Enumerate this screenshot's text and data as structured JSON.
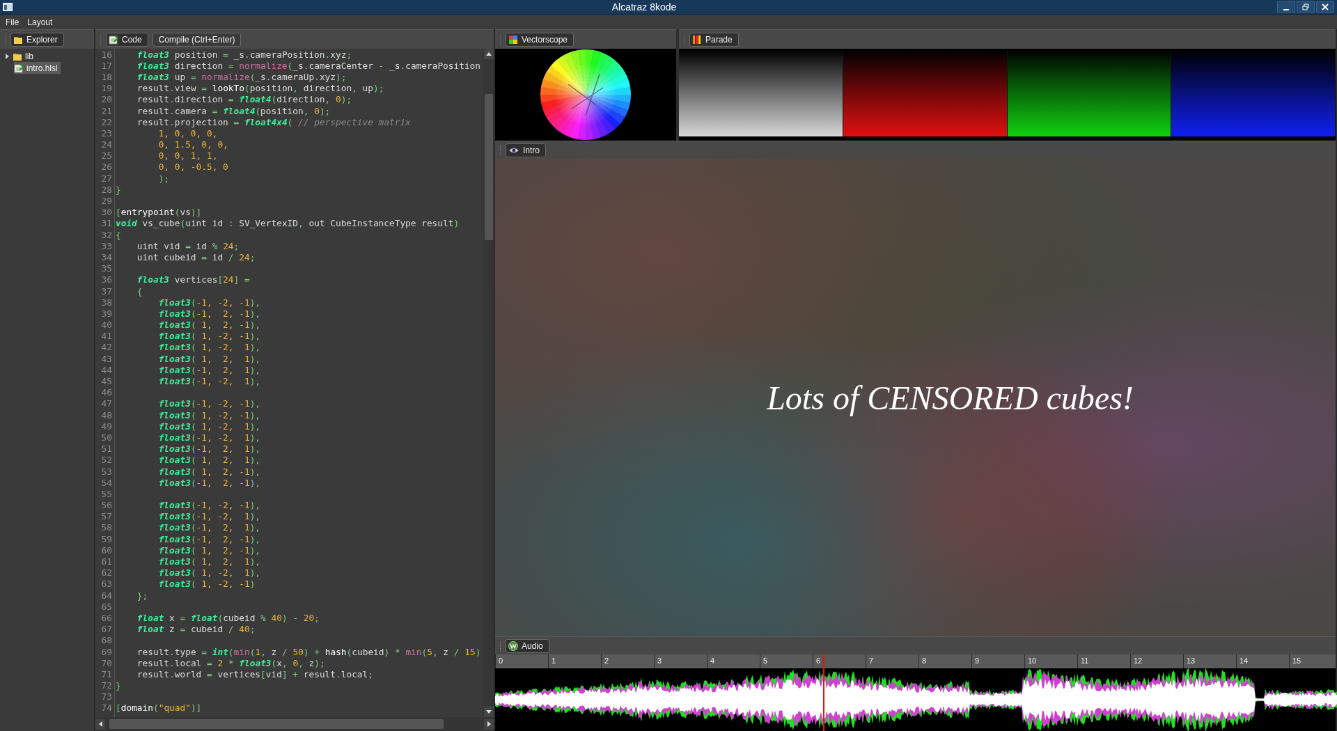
{
  "window": {
    "title": "Alcatraz 8kode"
  },
  "menu": [
    "File",
    "Layout"
  ],
  "explorer": {
    "tab": "Explorer",
    "items": [
      {
        "label": "lib",
        "kind": "folder",
        "expanded": false,
        "selected": false
      },
      {
        "label": "intro.hlsl",
        "kind": "file",
        "selected": true
      }
    ]
  },
  "editor": {
    "tab": "Code",
    "compile_button": "Compile (Ctrl+Enter)",
    "lines": [
      {
        "number": "16",
        "tokens": [
          {
            "kind": "type",
            "text": "    float3"
          },
          {
            "kind": "text",
            "text": " position = _s.cameraPosition.xyz;"
          }
        ]
      },
      {
        "number": "17",
        "tokens": [
          {
            "kind": "type",
            "text": "    float3"
          },
          {
            "kind": "text",
            "text": " direction = "
          },
          {
            "kind": "fn",
            "text": "normalize"
          },
          {
            "kind": "text",
            "text": "(_s.cameraCenter - _s.cameraPosition"
          }
        ]
      },
      {
        "number": "18",
        "tokens": [
          {
            "kind": "type",
            "text": "    float3"
          },
          {
            "kind": "text",
            "text": " up = "
          },
          {
            "kind": "fn",
            "text": "normalize"
          },
          {
            "kind": "text",
            "text": "(_s.cameraUp.xyz);"
          }
        ]
      },
      {
        "number": "19",
        "tokens": [
          {
            "kind": "text",
            "text": "    result.view = "
          },
          {
            "kind": "call",
            "text": "lookTo"
          },
          {
            "kind": "text",
            "text": "(position, direction, up);"
          }
        ]
      },
      {
        "number": "20",
        "tokens": [
          {
            "kind": "text",
            "text": "    result.direction = "
          },
          {
            "kind": "type",
            "text": "float4"
          },
          {
            "kind": "text",
            "text": "(direction, "
          },
          {
            "kind": "num",
            "text": "0"
          },
          {
            "kind": "text",
            "text": ");"
          }
        ]
      },
      {
        "number": "21",
        "tokens": [
          {
            "kind": "text",
            "text": "    result.camera = "
          },
          {
            "kind": "type",
            "text": "float4"
          },
          {
            "kind": "text",
            "text": "(position, "
          },
          {
            "kind": "num",
            "text": "0"
          },
          {
            "kind": "text",
            "text": ");"
          }
        ]
      },
      {
        "number": "22",
        "tokens": [
          {
            "kind": "text",
            "text": "    result.projection = "
          },
          {
            "kind": "type",
            "text": "float4x4"
          },
          {
            "kind": "text",
            "text": "( "
          },
          {
            "kind": "comment",
            "text": "// perspective matrix"
          }
        ]
      },
      {
        "number": "23",
        "tokens": [
          {
            "kind": "num",
            "text": "        1, 0, 0, 0,"
          }
        ]
      },
      {
        "number": "24",
        "tokens": [
          {
            "kind": "num",
            "text": "        0, 1.5, 0, 0,"
          }
        ]
      },
      {
        "number": "25",
        "tokens": [
          {
            "kind": "num",
            "text": "        0, 0, 1, 1,"
          }
        ]
      },
      {
        "number": "26",
        "tokens": [
          {
            "kind": "num",
            "text": "        0, 0, -0.5, 0"
          }
        ]
      },
      {
        "number": "27",
        "tokens": [
          {
            "kind": "text",
            "text": "        );"
          }
        ]
      },
      {
        "number": "28",
        "tokens": [
          {
            "kind": "text",
            "text": "}"
          }
        ]
      },
      {
        "number": "29"
      },
      {
        "number": "30",
        "tokens": [
          {
            "kind": "text",
            "text": "["
          },
          {
            "kind": "call",
            "text": "entrypoint"
          },
          {
            "kind": "text",
            "text": "(vs)]"
          }
        ]
      },
      {
        "number": "31",
        "tokens": [
          {
            "kind": "type",
            "text": "void"
          },
          {
            "kind": "text",
            "text": " vs_cube(uint id : SV_VertexID, out CubeInstanceType result)"
          }
        ]
      },
      {
        "number": "32",
        "tokens": [
          {
            "kind": "text",
            "text": "{"
          }
        ]
      },
      {
        "number": "33",
        "tokens": [
          {
            "kind": "text",
            "text": "    uint vid = id % "
          },
          {
            "kind": "num",
            "text": "24"
          },
          {
            "kind": "text",
            "text": ";"
          }
        ]
      },
      {
        "number": "34",
        "tokens": [
          {
            "kind": "text",
            "text": "    uint cubeid = id / "
          },
          {
            "kind": "num",
            "text": "24"
          },
          {
            "kind": "text",
            "text": ";"
          }
        ]
      },
      {
        "number": "35"
      },
      {
        "number": "36",
        "tokens": [
          {
            "kind": "type",
            "text": "    float3"
          },
          {
            "kind": "text",
            "text": " vertices["
          },
          {
            "kind": "num",
            "text": "24"
          },
          {
            "kind": "text",
            "text": "] ="
          }
        ]
      },
      {
        "number": "37",
        "tokens": [
          {
            "kind": "text",
            "text": "    {"
          }
        ]
      },
      {
        "number": "38",
        "tokens": [
          {
            "kind": "type",
            "text": "        float3"
          },
          {
            "kind": "text",
            "text": "("
          },
          {
            "kind": "num",
            "text": "-1, -2, -1"
          },
          {
            "kind": "text",
            "text": "),"
          }
        ]
      },
      {
        "number": "39",
        "tokens": [
          {
            "kind": "type",
            "text": "        float3"
          },
          {
            "kind": "text",
            "text": "("
          },
          {
            "kind": "num",
            "text": "-1,  2, -1"
          },
          {
            "kind": "text",
            "text": "),"
          }
        ]
      },
      {
        "number": "40",
        "tokens": [
          {
            "kind": "type",
            "text": "        float3"
          },
          {
            "kind": "text",
            "text": "("
          },
          {
            "kind": "num",
            "text": " 1,  2, -1"
          },
          {
            "kind": "text",
            "text": "),"
          }
        ]
      },
      {
        "number": "41",
        "tokens": [
          {
            "kind": "type",
            "text": "        float3"
          },
          {
            "kind": "text",
            "text": "("
          },
          {
            "kind": "num",
            "text": " 1, -2, -1"
          },
          {
            "kind": "text",
            "text": "),"
          }
        ]
      },
      {
        "number": "42",
        "tokens": [
          {
            "kind": "type",
            "text": "        float3"
          },
          {
            "kind": "text",
            "text": "("
          },
          {
            "kind": "num",
            "text": " 1, -2,  1"
          },
          {
            "kind": "text",
            "text": "),"
          }
        ]
      },
      {
        "number": "43",
        "tokens": [
          {
            "kind": "type",
            "text": "        float3"
          },
          {
            "kind": "text",
            "text": "("
          },
          {
            "kind": "num",
            "text": " 1,  2,  1"
          },
          {
            "kind": "text",
            "text": "),"
          }
        ]
      },
      {
        "number": "44",
        "tokens": [
          {
            "kind": "type",
            "text": "        float3"
          },
          {
            "kind": "text",
            "text": "("
          },
          {
            "kind": "num",
            "text": "-1,  2,  1"
          },
          {
            "kind": "text",
            "text": "),"
          }
        ]
      },
      {
        "number": "45",
        "tokens": [
          {
            "kind": "type",
            "text": "        float3"
          },
          {
            "kind": "text",
            "text": "("
          },
          {
            "kind": "num",
            "text": "-1, -2,  1"
          },
          {
            "kind": "text",
            "text": "),"
          }
        ]
      },
      {
        "number": "46"
      },
      {
        "number": "47",
        "tokens": [
          {
            "kind": "type",
            "text": "        float3"
          },
          {
            "kind": "text",
            "text": "("
          },
          {
            "kind": "num",
            "text": "-1, -2, -1"
          },
          {
            "kind": "text",
            "text": "),"
          }
        ]
      },
      {
        "number": "48",
        "tokens": [
          {
            "kind": "type",
            "text": "        float3"
          },
          {
            "kind": "text",
            "text": "("
          },
          {
            "kind": "num",
            "text": " 1, -2, -1"
          },
          {
            "kind": "text",
            "text": "),"
          }
        ]
      },
      {
        "number": "49",
        "tokens": [
          {
            "kind": "type",
            "text": "        float3"
          },
          {
            "kind": "text",
            "text": "("
          },
          {
            "kind": "num",
            "text": " 1, -2,  1"
          },
          {
            "kind": "text",
            "text": "),"
          }
        ]
      },
      {
        "number": "50",
        "tokens": [
          {
            "kind": "type",
            "text": "        float3"
          },
          {
            "kind": "text",
            "text": "("
          },
          {
            "kind": "num",
            "text": "-1, -2,  1"
          },
          {
            "kind": "text",
            "text": "),"
          }
        ]
      },
      {
        "number": "51",
        "tokens": [
          {
            "kind": "type",
            "text": "        float3"
          },
          {
            "kind": "text",
            "text": "("
          },
          {
            "kind": "num",
            "text": "-1,  2,  1"
          },
          {
            "kind": "text",
            "text": "),"
          }
        ]
      },
      {
        "number": "52",
        "tokens": [
          {
            "kind": "type",
            "text": "        float3"
          },
          {
            "kind": "text",
            "text": "("
          },
          {
            "kind": "num",
            "text": " 1,  2,  1"
          },
          {
            "kind": "text",
            "text": "),"
          }
        ]
      },
      {
        "number": "53",
        "tokens": [
          {
            "kind": "type",
            "text": "        float3"
          },
          {
            "kind": "text",
            "text": "("
          },
          {
            "kind": "num",
            "text": " 1,  2, -1"
          },
          {
            "kind": "text",
            "text": "),"
          }
        ]
      },
      {
        "number": "54",
        "tokens": [
          {
            "kind": "type",
            "text": "        float3"
          },
          {
            "kind": "text",
            "text": "("
          },
          {
            "kind": "num",
            "text": "-1,  2, -1"
          },
          {
            "kind": "text",
            "text": "),"
          }
        ]
      },
      {
        "number": "55"
      },
      {
        "number": "56",
        "tokens": [
          {
            "kind": "type",
            "text": "        float3"
          },
          {
            "kind": "text",
            "text": "("
          },
          {
            "kind": "num",
            "text": "-1, -2, -1"
          },
          {
            "kind": "text",
            "text": "),"
          }
        ]
      },
      {
        "number": "57",
        "tokens": [
          {
            "kind": "type",
            "text": "        float3"
          },
          {
            "kind": "text",
            "text": "("
          },
          {
            "kind": "num",
            "text": "-1, -2,  1"
          },
          {
            "kind": "text",
            "text": "),"
          }
        ]
      },
      {
        "number": "58",
        "tokens": [
          {
            "kind": "type",
            "text": "        float3"
          },
          {
            "kind": "text",
            "text": "("
          },
          {
            "kind": "num",
            "text": "-1,  2,  1"
          },
          {
            "kind": "text",
            "text": "),"
          }
        ]
      },
      {
        "number": "59",
        "tokens": [
          {
            "kind": "type",
            "text": "        float3"
          },
          {
            "kind": "text",
            "text": "("
          },
          {
            "kind": "num",
            "text": "-1,  2, -1"
          },
          {
            "kind": "text",
            "text": "),"
          }
        ]
      },
      {
        "number": "60",
        "tokens": [
          {
            "kind": "type",
            "text": "        float3"
          },
          {
            "kind": "text",
            "text": "("
          },
          {
            "kind": "num",
            "text": " 1,  2, -1"
          },
          {
            "kind": "text",
            "text": "),"
          }
        ]
      },
      {
        "number": "61",
        "tokens": [
          {
            "kind": "type",
            "text": "        float3"
          },
          {
            "kind": "text",
            "text": "("
          },
          {
            "kind": "num",
            "text": " 1,  2,  1"
          },
          {
            "kind": "text",
            "text": "),"
          }
        ]
      },
      {
        "number": "62",
        "tokens": [
          {
            "kind": "type",
            "text": "        float3"
          },
          {
            "kind": "text",
            "text": "("
          },
          {
            "kind": "num",
            "text": " 1, -2,  1"
          },
          {
            "kind": "text",
            "text": "),"
          }
        ]
      },
      {
        "number": "63",
        "tokens": [
          {
            "kind": "type",
            "text": "        float3"
          },
          {
            "kind": "text",
            "text": "("
          },
          {
            "kind": "num",
            "text": " 1, -2, -1"
          },
          {
            "kind": "text",
            "text": ")"
          }
        ]
      },
      {
        "number": "64",
        "tokens": [
          {
            "kind": "text",
            "text": "    };"
          }
        ]
      },
      {
        "number": "65"
      },
      {
        "number": "66",
        "tokens": [
          {
            "kind": "type",
            "text": "    float"
          },
          {
            "kind": "text",
            "text": " x = "
          },
          {
            "kind": "type",
            "text": "float"
          },
          {
            "kind": "text",
            "text": "(cubeid % "
          },
          {
            "kind": "num",
            "text": "40"
          },
          {
            "kind": "text",
            "text": ") - "
          },
          {
            "kind": "num",
            "text": "20"
          },
          {
            "kind": "text",
            "text": ";"
          }
        ]
      },
      {
        "number": "67",
        "tokens": [
          {
            "kind": "type",
            "text": "    float"
          },
          {
            "kind": "text",
            "text": " z = cubeid / "
          },
          {
            "kind": "num",
            "text": "40"
          },
          {
            "kind": "text",
            "text": ";"
          }
        ]
      },
      {
        "number": "68"
      },
      {
        "number": "69",
        "tokens": [
          {
            "kind": "text",
            "text": "    result.type = "
          },
          {
            "kind": "type",
            "text": "int"
          },
          {
            "kind": "text",
            "text": "("
          },
          {
            "kind": "fn",
            "text": "min"
          },
          {
            "kind": "text",
            "text": "("
          },
          {
            "kind": "num",
            "text": "1"
          },
          {
            "kind": "text",
            "text": ", z / "
          },
          {
            "kind": "num",
            "text": "50"
          },
          {
            "kind": "text",
            "text": ") + "
          },
          {
            "kind": "call",
            "text": "hash"
          },
          {
            "kind": "text",
            "text": "(cubeid) * "
          },
          {
            "kind": "fn",
            "text": "min"
          },
          {
            "kind": "text",
            "text": "("
          },
          {
            "kind": "num",
            "text": "5"
          },
          {
            "kind": "text",
            "text": ", z / "
          },
          {
            "kind": "num",
            "text": "15"
          },
          {
            "kind": "text",
            "text": ")"
          }
        ]
      },
      {
        "number": "70",
        "tokens": [
          {
            "kind": "text",
            "text": "    result.local = "
          },
          {
            "kind": "num",
            "text": "2"
          },
          {
            "kind": "text",
            "text": " * "
          },
          {
            "kind": "type",
            "text": "float3"
          },
          {
            "kind": "text",
            "text": "(x, "
          },
          {
            "kind": "num",
            "text": "0"
          },
          {
            "kind": "text",
            "text": ", z);"
          }
        ]
      },
      {
        "number": "71",
        "tokens": [
          {
            "kind": "text",
            "text": "    result.world = vertices[vid] + result.local;"
          }
        ]
      },
      {
        "number": "72",
        "tokens": [
          {
            "kind": "text",
            "text": "}"
          }
        ]
      },
      {
        "number": "73"
      },
      {
        "number": "74",
        "tokens": [
          {
            "kind": "text",
            "text": "["
          },
          {
            "kind": "call",
            "text": "domain"
          },
          {
            "kind": "text",
            "text": "("
          },
          {
            "kind": "string",
            "text": "\"quad\""
          },
          {
            "kind": "text",
            "text": ")]"
          }
        ]
      }
    ]
  },
  "vectorscope": {
    "tab": "Vectorscope"
  },
  "parade": {
    "tab": "Parade"
  },
  "viewport": {
    "tab": "Intro",
    "caption": "Lots of CENSORED cubes!"
  },
  "audio": {
    "tab": "Audio",
    "ticks": [
      "0",
      "1",
      "2",
      "3",
      "4",
      "5",
      "6",
      "7",
      "8",
      "9",
      "10",
      "11",
      "12",
      "13",
      "14",
      "15"
    ],
    "level": 0.39
  }
}
